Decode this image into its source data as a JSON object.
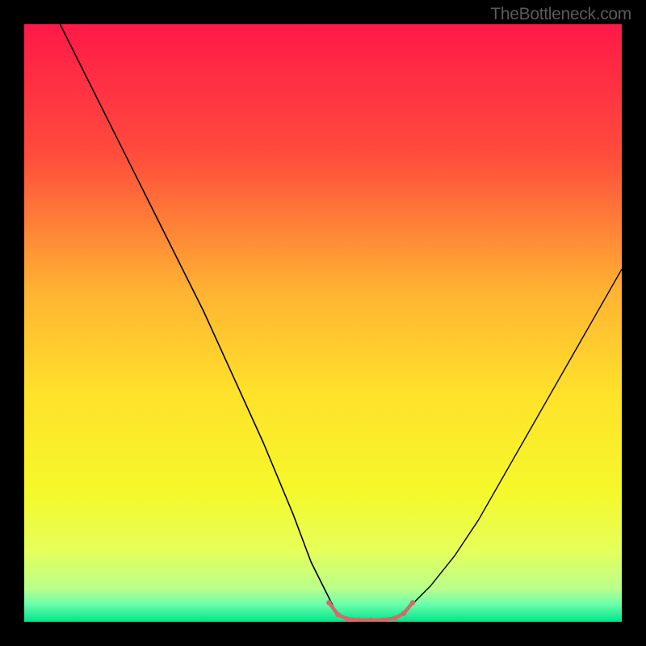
{
  "watermark": "TheBottleneck.com",
  "chart_data": {
    "type": "line",
    "title": "",
    "xlabel": "",
    "ylabel": "",
    "xlim": [
      0,
      100
    ],
    "ylim": [
      0,
      100
    ],
    "gradient_stops": [
      {
        "offset": 0,
        "color": "#ff1948"
      },
      {
        "offset": 0.22,
        "color": "#ff4d3c"
      },
      {
        "offset": 0.45,
        "color": "#ffb432"
      },
      {
        "offset": 0.62,
        "color": "#ffe22a"
      },
      {
        "offset": 0.78,
        "color": "#f5f82a"
      },
      {
        "offset": 0.88,
        "color": "#e6ff5a"
      },
      {
        "offset": 0.945,
        "color": "#b8ff8c"
      },
      {
        "offset": 0.97,
        "color": "#6cffad"
      },
      {
        "offset": 1.0,
        "color": "#00e58a"
      }
    ],
    "series": [
      {
        "name": "left-curve",
        "color": "#000000",
        "width": 1.6,
        "x": [
          6,
          10,
          15,
          20,
          25,
          30,
          35,
          40,
          45,
          48,
          50.5,
          52
        ],
        "y": [
          100,
          92,
          82,
          72,
          62,
          52,
          41,
          30,
          18,
          10,
          5,
          2
        ]
      },
      {
        "name": "right-curve",
        "color": "#000000",
        "width": 1.4,
        "x": [
          64,
          68,
          72,
          76,
          80,
          84,
          88,
          92,
          96,
          100
        ],
        "y": [
          2,
          6,
          11,
          17,
          24,
          31,
          38,
          45,
          52,
          59
        ]
      },
      {
        "name": "floor-segment",
        "color": "#d46a6a",
        "width": 4.5,
        "cap": "round",
        "x": [
          51,
          52.5,
          54,
          56,
          58,
          60,
          62,
          63.5,
          65
        ],
        "y": [
          3.2,
          1.2,
          0.5,
          0.3,
          0.3,
          0.3,
          0.6,
          1.4,
          3.2
        ]
      }
    ],
    "floor_dots": {
      "color": "#d46a6a",
      "radius": 3.2,
      "points": [
        {
          "x": 51,
          "y": 3.2
        },
        {
          "x": 52.5,
          "y": 1.2
        },
        {
          "x": 54,
          "y": 0.5
        },
        {
          "x": 56,
          "y": 0.3
        },
        {
          "x": 58,
          "y": 0.3
        },
        {
          "x": 60,
          "y": 0.3
        },
        {
          "x": 62,
          "y": 0.6
        },
        {
          "x": 63.5,
          "y": 1.4
        },
        {
          "x": 65,
          "y": 3.2
        }
      ]
    }
  }
}
